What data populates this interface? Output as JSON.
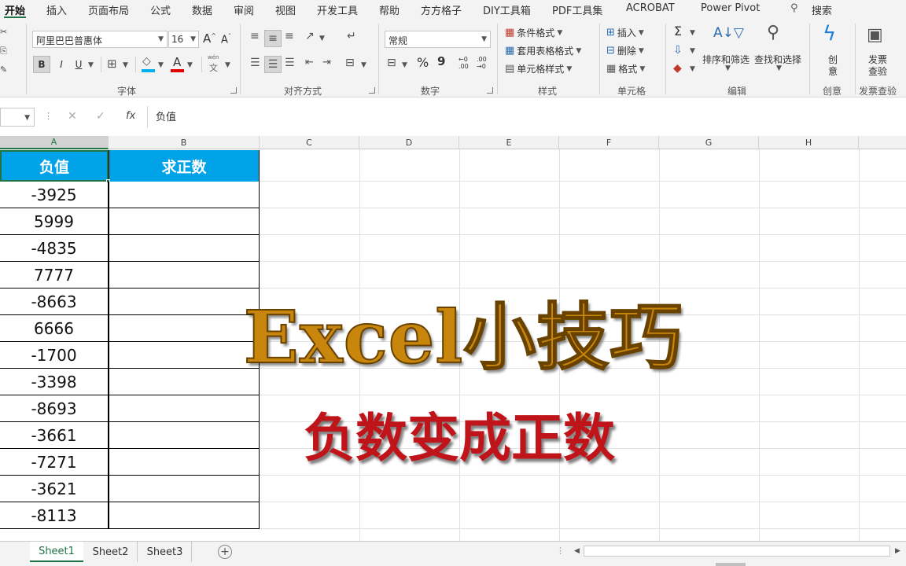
{
  "ribbon_tabs": [
    "开始",
    "插入",
    "页面布局",
    "公式",
    "数据",
    "审阅",
    "视图",
    "开发工具",
    "帮助",
    "方方格子",
    "DIY工具箱",
    "PDF工具集",
    "ACROBAT",
    "Power Pivot",
    "搜索"
  ],
  "font": {
    "name": "阿里巴巴普惠体",
    "size": "16",
    "bold": "B",
    "italic": "I",
    "underline": "U",
    "font_color_letter": "A",
    "wen": "wén",
    "wen_char": "文",
    "group_label": "字体"
  },
  "alignment": {
    "group_label": "对齐方式"
  },
  "number": {
    "format": "常规",
    "percent": "%",
    "comma": "9",
    "inc_decimal": "←0\n.00",
    "dec_decimal": ".00\n→0",
    "group_label": "数字"
  },
  "styles": {
    "conditional": "条件格式",
    "table": "套用表格格式",
    "cell": "单元格样式",
    "group_label": "样式"
  },
  "cells": {
    "insert": "插入",
    "delete": "删除",
    "format": "格式",
    "group_label": "单元格"
  },
  "editing": {
    "sigma": "Σ",
    "sort_filter": "排序和筛选",
    "find_select": "查找和选择",
    "group_label": "编辑"
  },
  "create": {
    "label_1": "创",
    "label_2": "意",
    "group_label": "创意"
  },
  "invoice": {
    "label_1": "发票",
    "label_2": "查验",
    "group_label": "发票查验"
  },
  "formula_bar": {
    "fx": "fx",
    "content": "负值"
  },
  "columns": [
    "A",
    "B",
    "C",
    "D",
    "E",
    "F",
    "G",
    "H"
  ],
  "table": {
    "headers": [
      "负值",
      "求正数"
    ],
    "values": [
      "-3925",
      "5999",
      "-4835",
      "7777",
      "-8663",
      "6666",
      "-1700",
      "-3398",
      "-8693",
      "-3661",
      "-7271",
      "-3621",
      "-8113"
    ]
  },
  "overlay": {
    "title": "Excel小技巧",
    "subtitle": "负数变成正数"
  },
  "sheets": [
    "Sheet1",
    "Sheet2",
    "Sheet3"
  ],
  "add_sheet": "+",
  "colors": {
    "header_fill": "#00a2e8",
    "excel_green": "#217346",
    "title_color": "#c8860c",
    "subtitle_color": "#c0141b"
  }
}
